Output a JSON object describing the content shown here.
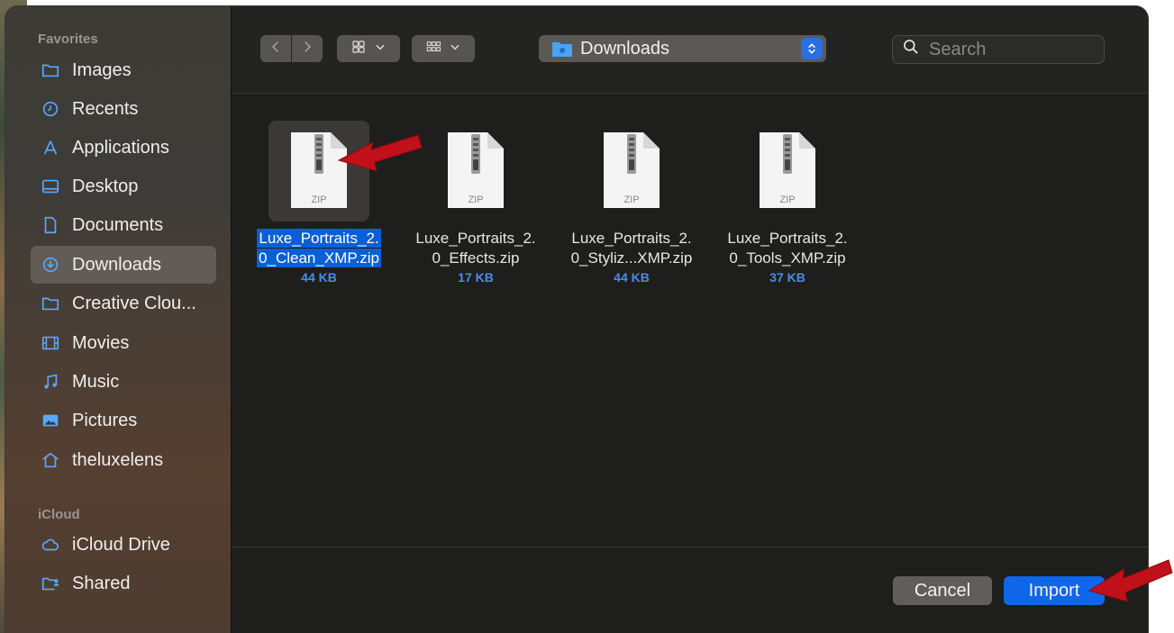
{
  "sidebar": {
    "favorites_heading": "Favorites",
    "icloud_heading": "iCloud",
    "favorites": [
      {
        "label": "Images",
        "icon": "folder-icon"
      },
      {
        "label": "Recents",
        "icon": "clock-icon"
      },
      {
        "label": "Applications",
        "icon": "applications-icon"
      },
      {
        "label": "Desktop",
        "icon": "desktop-icon"
      },
      {
        "label": "Documents",
        "icon": "document-icon"
      },
      {
        "label": "Downloads",
        "icon": "download-icon",
        "selected": true
      },
      {
        "label": "Creative Clou...",
        "icon": "folder-icon"
      },
      {
        "label": "Movies",
        "icon": "film-icon"
      },
      {
        "label": "Music",
        "icon": "music-icon"
      },
      {
        "label": "Pictures",
        "icon": "picture-icon"
      },
      {
        "label": "theluxelens",
        "icon": "home-icon"
      }
    ],
    "icloud": [
      {
        "label": "iCloud Drive",
        "icon": "cloud-icon"
      },
      {
        "label": "Shared",
        "icon": "shared-folder-icon"
      }
    ]
  },
  "toolbar": {
    "location": "Downloads",
    "search_placeholder": "Search"
  },
  "files": [
    {
      "line1": "Luxe_Portraits_2.",
      "line2": "0_Clean_XMP.zip",
      "size": "44 KB",
      "badge": "ZIP",
      "selected": true
    },
    {
      "line1": "Luxe_Portraits_2.",
      "line2": "0_Effects.zip",
      "size": "17 KB",
      "badge": "ZIP",
      "selected": false
    },
    {
      "line1": "Luxe_Portraits_2.",
      "line2": "0_Styliz...XMP.zip",
      "size": "44 KB",
      "badge": "ZIP",
      "selected": false
    },
    {
      "line1": "Luxe_Portraits_2.",
      "line2": "0_Tools_XMP.zip",
      "size": "37 KB",
      "badge": "ZIP",
      "selected": false
    }
  ],
  "footer": {
    "cancel_label": "Cancel",
    "import_label": "Import"
  },
  "colors": {
    "accent": "#1066e8",
    "selection": "#0a5fd6",
    "annotation_arrow": "#c0101a"
  }
}
